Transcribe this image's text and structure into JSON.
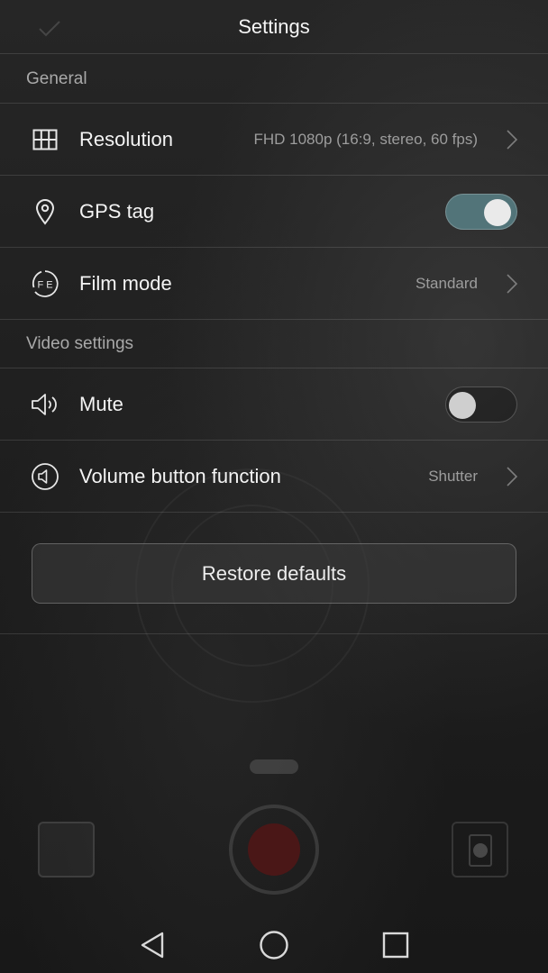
{
  "header": {
    "title": "Settings"
  },
  "sections": {
    "general": "General",
    "video": "Video settings"
  },
  "rows": {
    "resolution": {
      "label": "Resolution",
      "value": "FHD 1080p (16:9, stereo, 60 fps)",
      "icon": "grid-icon"
    },
    "gps_tag": {
      "label": "GPS tag",
      "toggle": "on",
      "icon": "location-pin-icon"
    },
    "film_mode": {
      "label": "Film mode",
      "value": "Standard",
      "icon": "film-mode-fe-icon",
      "icon_text": "F E"
    },
    "mute": {
      "label": "Mute",
      "toggle": "off",
      "icon": "speaker-icon"
    },
    "volume_button": {
      "label": "Volume button function",
      "value": "Shutter",
      "icon": "volume-button-icon"
    }
  },
  "restore_button": {
    "label": "Restore defaults"
  },
  "colors": {
    "toggle_on": "#527479",
    "background": "#1b1b1b",
    "text_primary": "#f4f4f4",
    "text_secondary": "#9d9d9d"
  },
  "navbar": {
    "buttons": [
      "back-triangle-icon",
      "home-circle-icon",
      "recents-square-icon"
    ]
  }
}
